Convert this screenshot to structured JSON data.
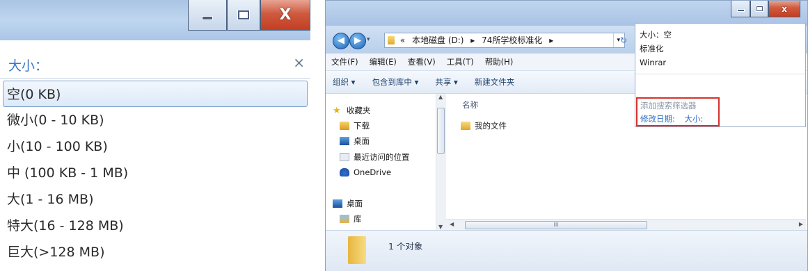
{
  "left_panel": {
    "header_label": "大小：",
    "close_glyph": "×",
    "size_options": [
      "空(0 KB)",
      "微小(0 - 10 KB)",
      "小(10 - 100 KB)",
      "中 (100 KB - 1 MB)",
      "大(1 - 16 MB)",
      "特大(16 - 128 MB)",
      "巨大(>128 MB)"
    ],
    "selected_index": 0
  },
  "explorer": {
    "address": {
      "chevrons": "«",
      "crumb1": "本地磁盘 (D:)",
      "sep": "▸",
      "crumb2": "74所学校标准化",
      "sep2": "▸"
    },
    "menu": [
      "文件(F)",
      "编辑(E)",
      "查看(V)",
      "工具(T)",
      "帮助(H)"
    ],
    "toolbar": [
      "组织 ▾",
      "包含到库中 ▾",
      "共享 ▾",
      "新建文件夹"
    ],
    "nav": {
      "favorites": "收藏夹",
      "downloads": "下载",
      "desktop": "桌面",
      "recent": "最近访问的位置",
      "onedrive": "OneDrive",
      "desktop2": "桌面",
      "library": "库"
    },
    "column_header": "名称",
    "folder_name": "我的文件",
    "status": "1 个对象",
    "search": {
      "suggestions": [
        "大小：空",
        "标准化",
        "Winrar"
      ],
      "filter_title": "添加搜索筛选器",
      "filter_date": "修改日期:",
      "filter_size": "大小:"
    },
    "hscroll_grip": "III"
  }
}
